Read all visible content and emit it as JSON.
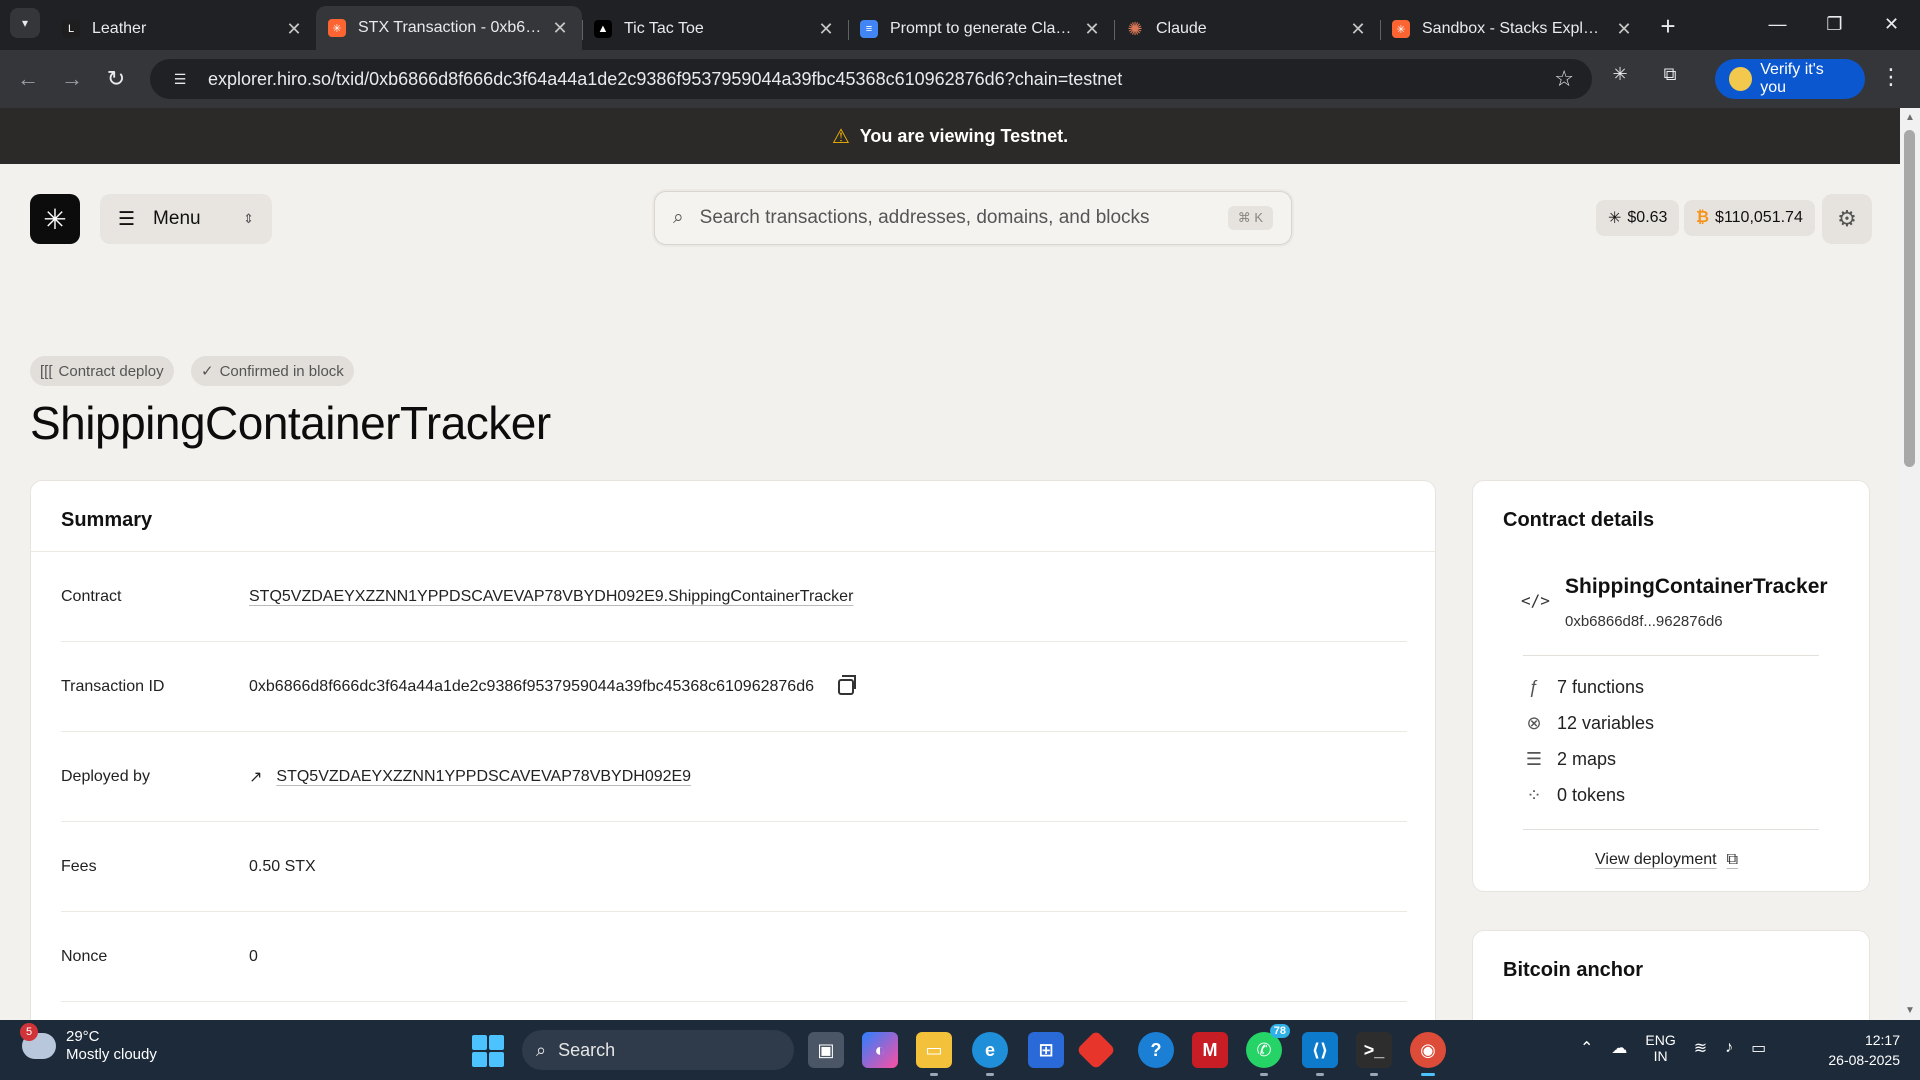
{
  "browser": {
    "tabs": [
      {
        "label": "Leather",
        "favicon_color": "#1e1e1e",
        "favicon_glyph": "L",
        "active": false
      },
      {
        "label": "STX Transaction - 0xb6866…",
        "favicon_color": "#fc6432",
        "favicon_glyph": "✳",
        "active": true
      },
      {
        "label": "Tic Tac Toe",
        "favicon_color": "#000000",
        "favicon_glyph": "▲",
        "active": false
      },
      {
        "label": "Prompt to generate Clarity",
        "favicon_color": "#4285f4",
        "favicon_glyph": "≡",
        "active": false
      },
      {
        "label": "Claude",
        "favicon_color": "#d97757",
        "favicon_glyph": "✺",
        "active": false
      },
      {
        "label": "Sandbox - Stacks Explorer",
        "favicon_color": "#fc6432",
        "favicon_glyph": "✳",
        "active": false
      }
    ],
    "url": "explorer.hiro.so/txid/0xb6866d8f666dc3f64a44a1de2c9386f9537959044a39fbc45368c610962876d6?chain=testnet",
    "verify_label": "Verify it's you"
  },
  "banner": {
    "text": "You are viewing Testnet."
  },
  "header": {
    "menu_label": "Menu",
    "search_placeholder": "Search transactions, addresses, domains, and blocks",
    "search_shortcut": "⌘ K",
    "stx_price": "$0.63",
    "btc_price": "$110,051.74"
  },
  "tx": {
    "badges": [
      "Contract deploy",
      "Confirmed in block"
    ],
    "title": "ShippingContainerTracker"
  },
  "summary": {
    "title": "Summary",
    "rows": [
      {
        "label": "Contract",
        "value": "STQ5VZDAEYXZZNN1YPPDSCAVEVAP78VBYDH092E9.ShippingContainerTracker"
      },
      {
        "label": "Transaction ID",
        "value": "0xb6866d8f666dc3f64a44a1de2c9386f9537959044a39fbc45368c610962876d6"
      },
      {
        "label": "Deployed by",
        "value": "STQ5VZDAEYXZZNN1YPPDSCAVEVAP78VBYDH092E9"
      },
      {
        "label": "Fees",
        "value": "0.50 STX"
      },
      {
        "label": "Nonce",
        "value": "0"
      }
    ]
  },
  "contract_details": {
    "title": "Contract details",
    "name": "ShippingContainerTracker",
    "hash": "0xb6866d8f...962876d6",
    "functions": "7 functions",
    "variables": "12 variables",
    "maps": "2 maps",
    "tokens": "0 tokens",
    "view_deployment": "View deployment"
  },
  "bitcoin_anchor": {
    "title": "Bitcoin anchor"
  },
  "taskbar": {
    "weather_temp": "29°C",
    "weather_desc": "Mostly cloudy",
    "weather_badge": "5",
    "search_label": "Search",
    "whatsapp_count": "78",
    "lang_line1": "ENG",
    "lang_line2": "IN",
    "time": "12:17",
    "date": "26-08-2025"
  }
}
